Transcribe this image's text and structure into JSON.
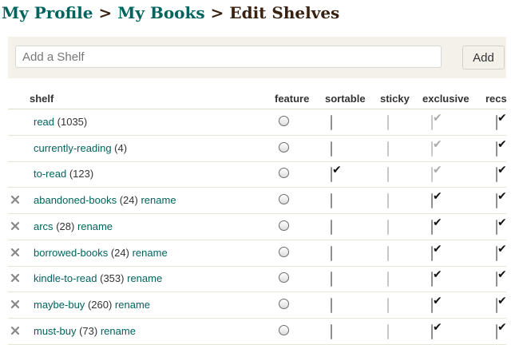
{
  "breadcrumb": {
    "items": [
      "My Profile",
      "My Books"
    ],
    "separator": ">",
    "current": "Edit Shelves"
  },
  "add_shelf": {
    "placeholder": "Add a Shelf",
    "button_label": "Add"
  },
  "columns": {
    "shelf": "shelf",
    "feature": "feature",
    "sortable": "sortable",
    "sticky": "sticky",
    "exclusive": "exclusive",
    "recs": "recs"
  },
  "rename_label": "rename",
  "shelves": [
    {
      "name": "read",
      "count": "(1035)",
      "deletable": false,
      "sortable": false,
      "sticky": false,
      "exclusive": true,
      "exclusive_disabled": true,
      "recs": true
    },
    {
      "name": "currently-reading",
      "count": "(4)",
      "deletable": false,
      "sortable": false,
      "sticky": false,
      "exclusive": true,
      "exclusive_disabled": true,
      "recs": true
    },
    {
      "name": "to-read",
      "count": "(123)",
      "deletable": false,
      "sortable": true,
      "sticky": false,
      "exclusive": true,
      "exclusive_disabled": true,
      "recs": true
    },
    {
      "name": "abandoned-books",
      "count": "(24)",
      "deletable": true,
      "sortable": false,
      "sticky": false,
      "exclusive": true,
      "exclusive_disabled": false,
      "recs": true
    },
    {
      "name": "arcs",
      "count": "(28)",
      "deletable": true,
      "sortable": false,
      "sticky": false,
      "exclusive": true,
      "exclusive_disabled": false,
      "recs": true
    },
    {
      "name": "borrowed-books",
      "count": "(24)",
      "deletable": true,
      "sortable": false,
      "sticky": false,
      "exclusive": true,
      "exclusive_disabled": false,
      "recs": true
    },
    {
      "name": "kindle-to-read",
      "count": "(353)",
      "deletable": true,
      "sortable": false,
      "sticky": false,
      "exclusive": true,
      "exclusive_disabled": false,
      "recs": true
    },
    {
      "name": "maybe-buy",
      "count": "(260)",
      "deletable": true,
      "sortable": false,
      "sticky": false,
      "exclusive": true,
      "exclusive_disabled": false,
      "recs": true
    },
    {
      "name": "must-buy",
      "count": "(73)",
      "deletable": true,
      "sortable": false,
      "sticky": false,
      "exclusive": true,
      "exclusive_disabled": false,
      "recs": true
    }
  ],
  "colors": {
    "link": "#00635d",
    "heading": "#382110",
    "panel_bg": "#f4f1ea"
  },
  "icons": {
    "delete": "close-icon",
    "checked": "checkmark-icon"
  }
}
